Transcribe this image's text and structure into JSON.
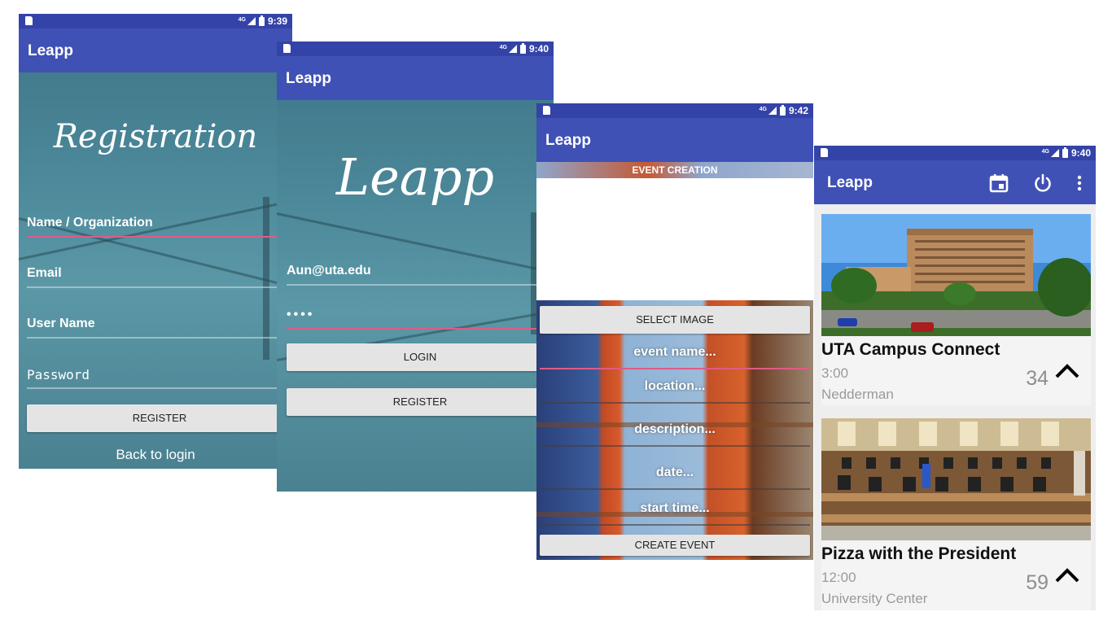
{
  "screens": {
    "registration": {
      "status_time": "9:39",
      "network": "4G",
      "app_title": "Leapp",
      "heading": "Registration",
      "fields": [
        {
          "text": "Name / Organization"
        },
        {
          "text": "Email"
        },
        {
          "text": "User Name"
        },
        {
          "text": "Password"
        }
      ],
      "register_label": "REGISTER",
      "back_link": "Back to login"
    },
    "login": {
      "status_time": "9:40",
      "network": "4G",
      "app_title": "Leapp",
      "logo": "Leapp",
      "email_value": "Aun@uta.edu",
      "password_value": "••••",
      "login_label": "LOGIN",
      "register_label": "REGISTER"
    },
    "create_event": {
      "status_time": "9:42",
      "network": "4G",
      "app_title": "Leapp",
      "section_label": "EVENT CREATION",
      "select_image_label": "SELECT IMAGE",
      "placeholders": [
        "event name...",
        "location...",
        "description...",
        "date...",
        "start time..."
      ],
      "create_label": "CREATE EVENT"
    },
    "event_feed": {
      "status_time": "9:40",
      "network": "4G",
      "app_title": "Leapp",
      "action_icons": [
        "calendar-icon",
        "power-icon",
        "overflow-menu-icon"
      ],
      "events": [
        {
          "name": "UTA Campus Connect",
          "time": "3:00",
          "location": "Nedderman",
          "count": "34"
        },
        {
          "name": "Pizza with the President",
          "time": "12:00",
          "location": "University Center",
          "count": "59"
        }
      ]
    }
  },
  "colors": {
    "status_bar": "#3443a7",
    "app_bar": "#3f51b5",
    "accent": "#e05b86",
    "button": "#e4e4e4"
  }
}
